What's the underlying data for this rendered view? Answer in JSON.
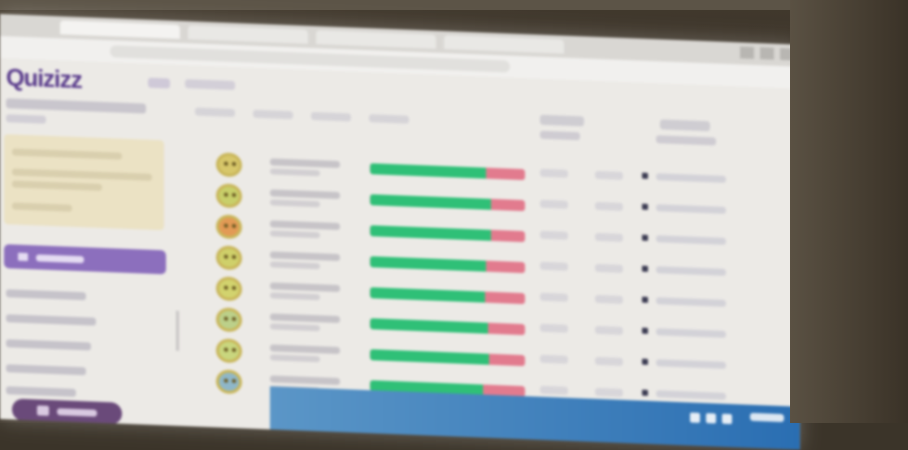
{
  "app": {
    "logo_text": "Quizizz"
  },
  "students": [
    {
      "accuracy": 0.75
    },
    {
      "accuracy": 0.78
    },
    {
      "accuracy": 0.78
    },
    {
      "accuracy": 0.75
    },
    {
      "accuracy": 0.74
    },
    {
      "accuracy": 0.76
    },
    {
      "accuracy": 0.77
    },
    {
      "accuracy": 0.73
    }
  ],
  "colors": {
    "brand_purple": "#8c6fbd",
    "correct_green": "#2fc077",
    "incorrect_red": "#e27b8e",
    "taskbar_blue": "#2a6eb2"
  },
  "icons": {
    "avatar": "monster-avatar-icon",
    "action": "square-icon",
    "primary_button": "users-icon"
  }
}
